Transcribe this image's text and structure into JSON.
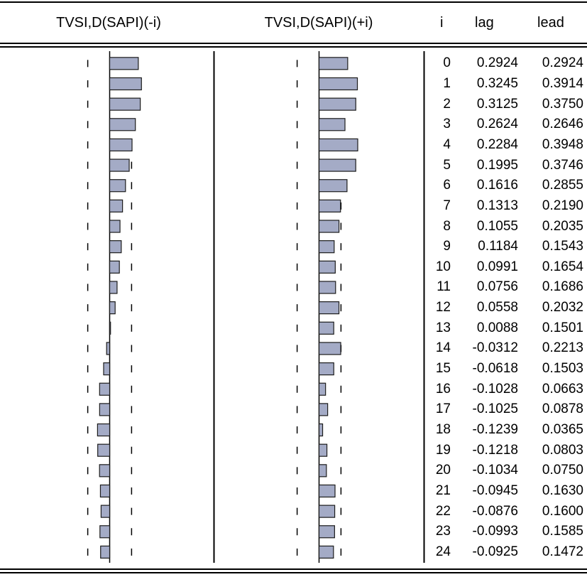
{
  "headers": {
    "lag_chart": "TVSI,D(SAPI)(-i)",
    "lead_chart": "TVSI,D(SAPI)(+i)",
    "i": "i",
    "lag": "lag",
    "lead": "lead"
  },
  "colors": {
    "bar_fill": "#a4abc6",
    "bar_stroke": "#1c1c1c",
    "line": "#000000"
  },
  "chart_data": {
    "type": "bar",
    "orientation": "horizontal",
    "x": [
      0,
      1,
      2,
      3,
      4,
      5,
      6,
      7,
      8,
      9,
      10,
      11,
      12,
      13,
      14,
      15,
      16,
      17,
      18,
      19,
      20,
      21,
      22,
      23,
      24
    ],
    "series": [
      {
        "name": "lag",
        "values": [
          0.2924,
          0.3245,
          0.3125,
          0.2624,
          0.2284,
          0.1995,
          0.1616,
          0.1313,
          0.1055,
          0.1184,
          0.0991,
          0.0756,
          0.0558,
          0.0088,
          -0.0312,
          -0.0618,
          -0.1028,
          -0.1025,
          -0.1239,
          -0.1218,
          -0.1034,
          -0.0945,
          -0.0876,
          -0.0993,
          -0.0925
        ],
        "values_text": [
          "0.2924",
          "0.3245",
          "0.3125",
          "0.2624",
          "0.2284",
          "0.1995",
          "0.1616",
          "0.1313",
          "0.1055",
          "0.1184",
          "0.0991",
          "0.0756",
          "0.0558",
          "0.0088",
          "-0.0312",
          "-0.0618",
          "-0.1028",
          "-0.1025",
          "-0.1239",
          "-0.1218",
          "-0.1034",
          "-0.0945",
          "-0.0876",
          "-0.0993",
          "-0.0925"
        ]
      },
      {
        "name": "lead",
        "values": [
          0.2924,
          0.3914,
          0.375,
          0.2646,
          0.3948,
          0.3746,
          0.2855,
          0.219,
          0.2035,
          0.1543,
          0.1654,
          0.1686,
          0.2032,
          0.1501,
          0.2213,
          0.1503,
          0.0663,
          0.0878,
          0.0365,
          0.0803,
          0.075,
          0.163,
          0.16,
          0.1585,
          0.1472
        ],
        "values_text": [
          "0.2924",
          "0.3914",
          "0.3750",
          "0.2646",
          "0.3948",
          "0.3746",
          "0.2855",
          "0.2190",
          "0.2035",
          "0.1543",
          "0.1654",
          "0.1686",
          "0.2032",
          "0.1501",
          "0.2213",
          "0.1503",
          "0.0663",
          "0.0878",
          "0.0365",
          "0.0803",
          "0.0750",
          "0.1630",
          "0.1600",
          "0.1585",
          "0.1472"
        ]
      }
    ],
    "confidence_band": 0.2238,
    "xlim": [
      -0.3,
      1.0
    ]
  }
}
